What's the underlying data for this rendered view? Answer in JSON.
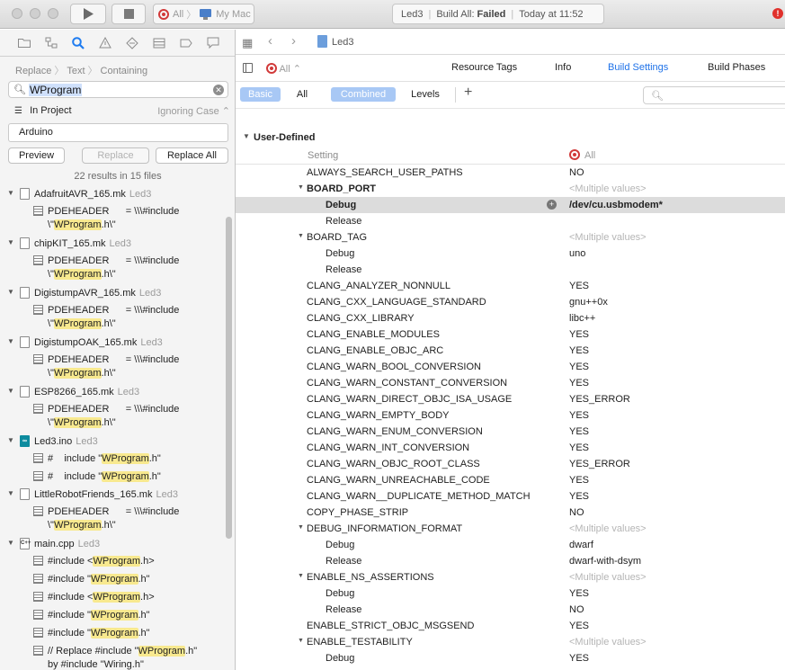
{
  "toolbar": {
    "scheme_target": "All",
    "scheme_destination": "My Mac",
    "activity_project": "Led3",
    "activity_status_label": "Build All:",
    "activity_status_value": "Failed",
    "activity_time": "Today at 11:52",
    "error_badge": "!"
  },
  "navigator": {
    "breadcrumb": [
      "Replace",
      "Text",
      "Containing"
    ],
    "search_value": "WProgram",
    "scope": "In Project",
    "case_mode": "Ignoring Case",
    "replace_value": "Arduino",
    "preview_label": "Preview",
    "replace_label": "Replace",
    "replace_all_label": "Replace All",
    "results_summary": "22 results in 15 files",
    "files": [
      {
        "name": "AdafruitAVR_165.mk",
        "project": "Led3",
        "icon": "file",
        "matches": [
          {
            "pre": "PDEHEADER      = \\\\\\#include\n\\\"",
            "hl": "WProgram",
            "post": ".h\\\""
          }
        ]
      },
      {
        "name": "chipKIT_165.mk",
        "project": "Led3",
        "icon": "file",
        "matches": [
          {
            "pre": "PDEHEADER      = \\\\\\#include\n\\\"",
            "hl": "WProgram",
            "post": ".h\\\""
          }
        ]
      },
      {
        "name": "DigistumpAVR_165.mk",
        "project": "Led3",
        "icon": "file",
        "matches": [
          {
            "pre": "PDEHEADER      = \\\\\\#include\n\\\"",
            "hl": "WProgram",
            "post": ".h\\\""
          }
        ]
      },
      {
        "name": "DigistumpOAK_165.mk",
        "project": "Led3",
        "icon": "file",
        "matches": [
          {
            "pre": "PDEHEADER      = \\\\\\#include\n\\\"",
            "hl": "WProgram",
            "post": ".h\\\""
          }
        ]
      },
      {
        "name": "ESP8266_165.mk",
        "project": "Led3",
        "icon": "file",
        "matches": [
          {
            "pre": "PDEHEADER      = \\\\\\#include\n\\\"",
            "hl": "WProgram",
            "post": ".h\\\""
          }
        ]
      },
      {
        "name": "Led3.ino",
        "project": "Led3",
        "icon": "ino",
        "matches": [
          {
            "pre": "#    include \"",
            "hl": "WProgram",
            "post": ".h\""
          },
          {
            "pre": "#    include \"",
            "hl": "WProgram",
            "post": ".h\""
          }
        ]
      },
      {
        "name": "LittleRobotFriends_165.mk",
        "project": "Led3",
        "icon": "file",
        "matches": [
          {
            "pre": "PDEHEADER      = \\\\\\#include\n\\\"",
            "hl": "WProgram",
            "post": ".h\\\""
          }
        ]
      },
      {
        "name": "main.cpp",
        "project": "Led3",
        "icon": "cpp",
        "matches": [
          {
            "pre": "#include <",
            "hl": "WProgram",
            "post": ".h>"
          },
          {
            "pre": "#include \"",
            "hl": "WProgram",
            "post": ".h\""
          },
          {
            "pre": "#include <",
            "hl": "WProgram",
            "post": ".h>"
          },
          {
            "pre": "#include \"",
            "hl": "WProgram",
            "post": ".h\""
          },
          {
            "pre": "#include \"",
            "hl": "WProgram",
            "post": ".h\""
          },
          {
            "pre": "// Replace #include \"",
            "hl": "WProgram",
            "post": ".h\"\nby #include \"Wiring.h\""
          }
        ]
      }
    ]
  },
  "editor": {
    "jump_bar_item": "Led3",
    "target_selector": "All",
    "tabs": [
      "Resource Tags",
      "Info",
      "Build Settings",
      "Build Phases"
    ],
    "active_tab": "Build Settings",
    "filters": {
      "basic": "Basic",
      "all": "All",
      "combined": "Combined",
      "levels": "Levels"
    },
    "group_name": "User-Defined",
    "column_setting": "Setting",
    "column_value": "All",
    "rows": [
      {
        "name": "ALWAYS_SEARCH_USER_PATHS",
        "value": "NO"
      },
      {
        "name": "BOARD_PORT",
        "value": "<Multiple values>",
        "expanded": true,
        "bold": true
      },
      {
        "name": "Debug",
        "value": "/dev/cu.usbmodem*",
        "sub": true,
        "selected": true
      },
      {
        "name": "Release",
        "value": "",
        "sub": true
      },
      {
        "name": "BOARD_TAG",
        "value": "<Multiple values>",
        "expanded": true
      },
      {
        "name": "Debug",
        "value": "uno",
        "sub": true
      },
      {
        "name": "Release",
        "value": "",
        "sub": true
      },
      {
        "name": "CLANG_ANALYZER_NONNULL",
        "value": "YES"
      },
      {
        "name": "CLANG_CXX_LANGUAGE_STANDARD",
        "value": "gnu++0x"
      },
      {
        "name": "CLANG_CXX_LIBRARY",
        "value": "libc++"
      },
      {
        "name": "CLANG_ENABLE_MODULES",
        "value": "YES"
      },
      {
        "name": "CLANG_ENABLE_OBJC_ARC",
        "value": "YES"
      },
      {
        "name": "CLANG_WARN_BOOL_CONVERSION",
        "value": "YES"
      },
      {
        "name": "CLANG_WARN_CONSTANT_CONVERSION",
        "value": "YES"
      },
      {
        "name": "CLANG_WARN_DIRECT_OBJC_ISA_USAGE",
        "value": "YES_ERROR"
      },
      {
        "name": "CLANG_WARN_EMPTY_BODY",
        "value": "YES"
      },
      {
        "name": "CLANG_WARN_ENUM_CONVERSION",
        "value": "YES"
      },
      {
        "name": "CLANG_WARN_INT_CONVERSION",
        "value": "YES"
      },
      {
        "name": "CLANG_WARN_OBJC_ROOT_CLASS",
        "value": "YES_ERROR"
      },
      {
        "name": "CLANG_WARN_UNREACHABLE_CODE",
        "value": "YES"
      },
      {
        "name": "CLANG_WARN__DUPLICATE_METHOD_MATCH",
        "value": "YES"
      },
      {
        "name": "COPY_PHASE_STRIP",
        "value": "NO"
      },
      {
        "name": "DEBUG_INFORMATION_FORMAT",
        "value": "<Multiple values>",
        "expanded": true
      },
      {
        "name": "Debug",
        "value": "dwarf",
        "sub": true
      },
      {
        "name": "Release",
        "value": "dwarf-with-dsym",
        "sub": true
      },
      {
        "name": "ENABLE_NS_ASSERTIONS",
        "value": "<Multiple values>",
        "expanded": true
      },
      {
        "name": "Debug",
        "value": "YES",
        "sub": true
      },
      {
        "name": "Release",
        "value": "NO",
        "sub": true
      },
      {
        "name": "ENABLE_STRICT_OBJC_MSGSEND",
        "value": "YES"
      },
      {
        "name": "ENABLE_TESTABILITY",
        "value": "<Multiple values>",
        "expanded": true
      },
      {
        "name": "Debug",
        "value": "YES",
        "sub": true
      }
    ]
  }
}
